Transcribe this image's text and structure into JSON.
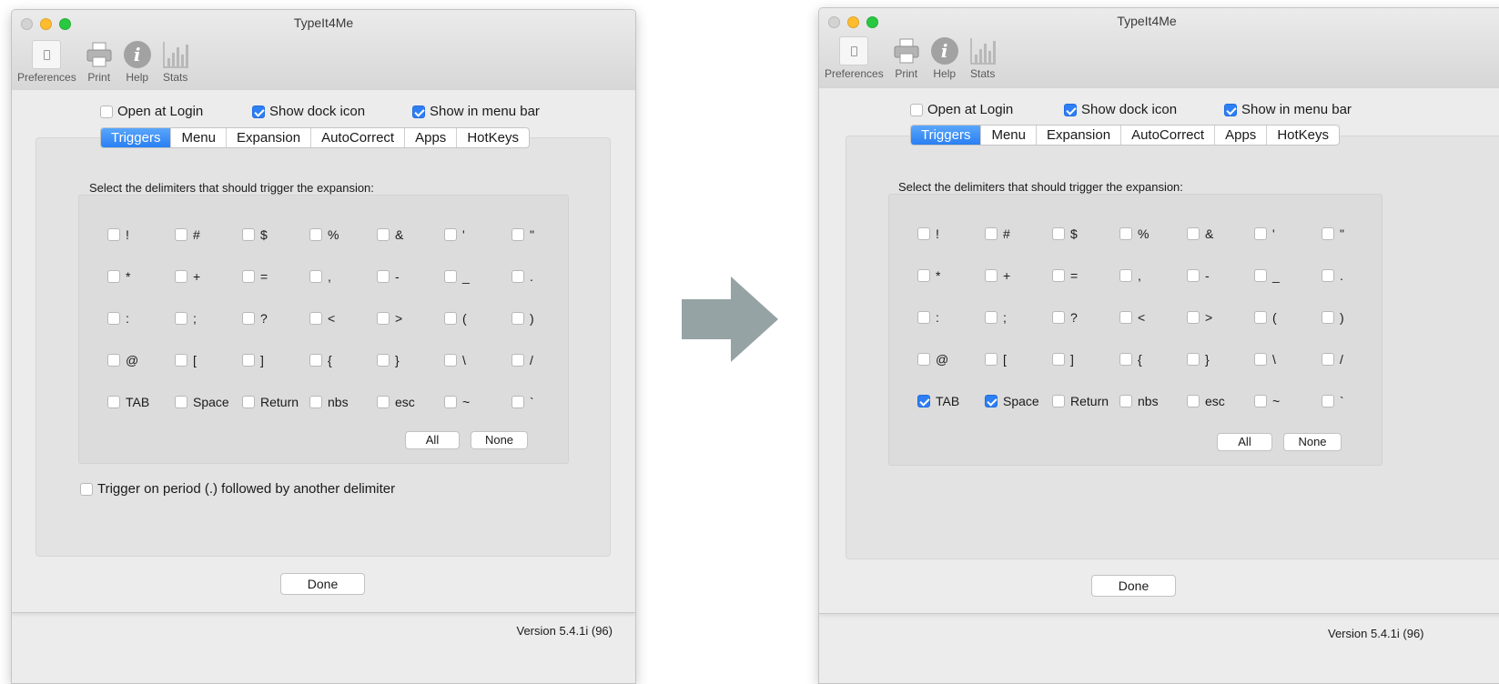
{
  "before": {
    "window_title": "TypeIt4Me",
    "toolbar": [
      {
        "label": "Preferences",
        "icon": "preferences-icon"
      },
      {
        "label": "Print",
        "icon": "printer-icon"
      },
      {
        "label": "Help",
        "icon": "info-icon"
      },
      {
        "label": "Stats",
        "icon": "bar-chart-icon"
      }
    ],
    "options": {
      "open_at_login": {
        "label": "Open at Login",
        "checked": false
      },
      "show_dock_icon": {
        "label": "Show dock icon",
        "checked": true
      },
      "show_in_menu_bar": {
        "label": "Show in menu bar",
        "checked": true
      }
    },
    "tabs": [
      "Triggers",
      "Menu",
      "Expansion",
      "AutoCorrect",
      "Apps",
      "HotKeys"
    ],
    "active_tab": "Triggers",
    "prompt": "Select the delimiters that should trigger the expansion:",
    "delimiters": [
      [
        "!",
        "#",
        "$",
        "%",
        "&",
        "'",
        "\""
      ],
      [
        "*",
        "+",
        "=",
        ",",
        "-",
        "_",
        "."
      ],
      [
        ":",
        ";",
        "?",
        "<",
        ">",
        "(",
        ")"
      ],
      [
        "@",
        "[",
        "]",
        "{",
        "}",
        "\\",
        "/"
      ],
      [
        "TAB",
        "Space",
        "Return",
        "nbs",
        "esc",
        "~",
        "`"
      ]
    ],
    "checked_delimiters": [],
    "all_label": "All",
    "none_label": "None",
    "period_trigger": {
      "label": "Trigger on period (.) followed by another delimiter",
      "checked": false
    },
    "done_label": "Done",
    "version": "Version 5.4.1i (96)"
  },
  "after": {
    "window_title": "TypeIt4Me",
    "toolbar": [
      {
        "label": "Preferences",
        "icon": "preferences-icon"
      },
      {
        "label": "Print",
        "icon": "printer-icon"
      },
      {
        "label": "Help",
        "icon": "info-icon"
      },
      {
        "label": "Stats",
        "icon": "bar-chart-icon"
      }
    ],
    "options": {
      "open_at_login": {
        "label": "Open at Login",
        "checked": false
      },
      "show_dock_icon": {
        "label": "Show dock icon",
        "checked": true
      },
      "show_in_menu_bar": {
        "label": "Show in menu bar",
        "checked": true
      }
    },
    "tabs": [
      "Triggers",
      "Menu",
      "Expansion",
      "AutoCorrect",
      "Apps",
      "HotKeys"
    ],
    "active_tab": "Triggers",
    "prompt": "Select the delimiters that should trigger the expansion:",
    "delimiters": [
      [
        "!",
        "#",
        "$",
        "%",
        "&",
        "'",
        "\""
      ],
      [
        "*",
        "+",
        "=",
        ",",
        "-",
        "_",
        "."
      ],
      [
        ":",
        ";",
        "?",
        "<",
        ">",
        "(",
        ")"
      ],
      [
        "@",
        "[",
        "]",
        "{",
        "}",
        "\\",
        "/"
      ],
      [
        "TAB",
        "Space",
        "Return",
        "nbs",
        "esc",
        "~",
        "`"
      ]
    ],
    "checked_delimiters": [
      "TAB",
      "Space"
    ],
    "all_label": "All",
    "none_label": "None",
    "done_label": "Done",
    "version": "Version 5.4.1i (96)"
  },
  "colors": {
    "arrow": "#95a3a5",
    "accent": "#2e7ff4"
  }
}
